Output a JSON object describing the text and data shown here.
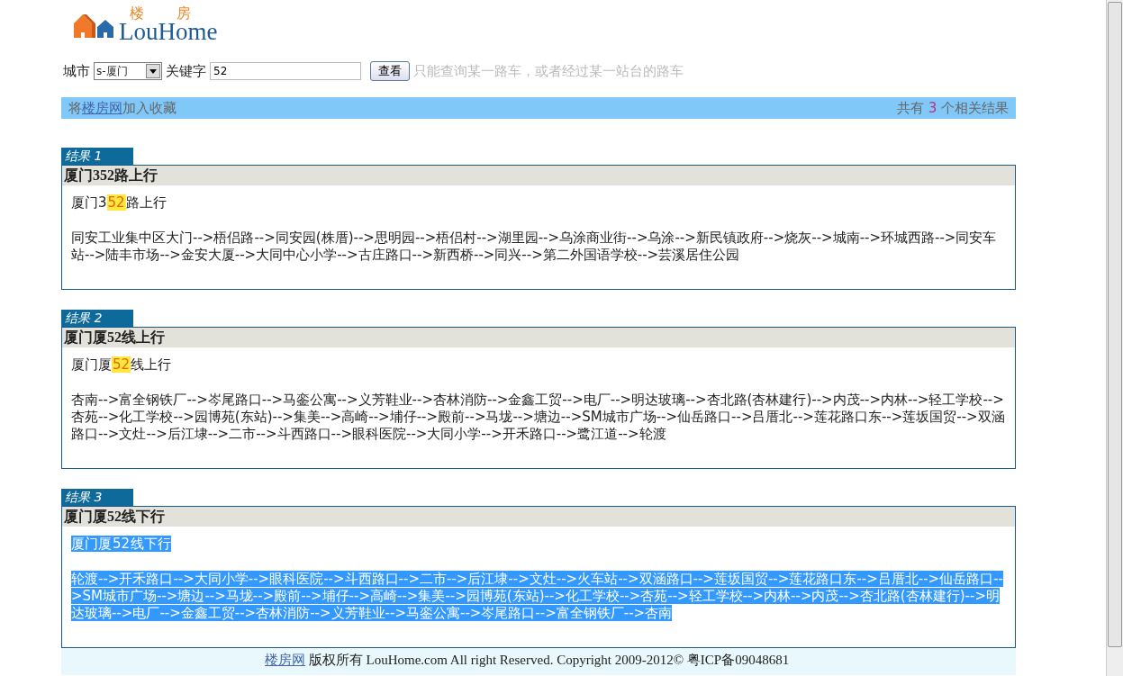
{
  "logo": {
    "top_left": "楼",
    "top_right": "房",
    "name": "LouHome"
  },
  "search": {
    "city_label": "城市",
    "city_value": "s-厦门",
    "keyword_label": "关键字",
    "keyword_value": "52",
    "button": "查看",
    "hint": "只能查询某一路车，或者经过某一站台的路车"
  },
  "info_bar": {
    "before": "将",
    "link": "楼房网",
    "after": "加入收藏",
    "count_before": "共有",
    "count": "3",
    "count_after": "个相关结果"
  },
  "results": [
    {
      "tab": "结果 1",
      "title": "厦门352路上行",
      "summary": {
        "before": "厦门3",
        "match": "52",
        "after": "路上行"
      },
      "route": "同安工业集中区大门-->梧侣路-->同安园(株厝)-->思明园-->梧侣村-->湖里园-->乌涂商业街-->乌涂-->新民镇政府-->烧灰-->城南-->环城西路-->同安车站-->陆丰市场-->金安大厦-->大同中心小学-->古庄路口-->新西桥-->同兴-->第二外国语学校-->芸溪居住公园",
      "selected": false
    },
    {
      "tab": "结果 2",
      "title": "厦门厦52线上行",
      "summary": {
        "before": "厦门厦",
        "match": "52",
        "after": "线上行"
      },
      "route": "杏南-->富全钢铁厂-->岑尾路口-->马銮公寓-->义芳鞋业-->杏林消防-->金鑫工贸-->电厂-->明达玻璃-->杏北路(杏林建行)-->内茂-->内林-->轻工学校-->杏苑-->化工学校-->园博苑(东站)-->集美-->高崎-->埔仔-->殿前-->马垅-->塘边-->SM城市广场-->仙岳路口-->吕厝北-->莲花路口东-->莲坂国贸-->双涵路口-->文灶-->后江埭-->二市-->斗西路口-->眼科医院-->大同小学-->开禾路口-->鹭江道-->轮渡",
      "selected": false
    },
    {
      "tab": "结果 3",
      "title": "厦门厦52线下行",
      "summary": {
        "before": "厦门厦",
        "match": "52",
        "after": "线下行"
      },
      "route": "轮渡-->开禾路口-->大同小学-->眼科医院-->斗西路口-->二市-->后江埭-->文灶-->火车站-->双涵路口-->莲坂国贸-->莲花路口东-->吕厝北-->仙岳路口-->SM城市广场-->塘边-->马垅-->殿前-->埔仔-->高崎-->集美-->园博苑(东站)-->化工学校-->杏苑-->轻工学校-->内林-->内茂-->杏北路(杏林建行)-->明达玻璃-->电厂-->金鑫工贸-->杏林消防-->义芳鞋业-->马銮公寓-->岑尾路口-->富全钢铁厂-->杏南",
      "selected": true
    }
  ],
  "footer": {
    "link": "楼房网",
    "text": "版权所有 LouHome.com All right Reserved. Copyright 2009-2012© 粤ICP备09048681"
  }
}
